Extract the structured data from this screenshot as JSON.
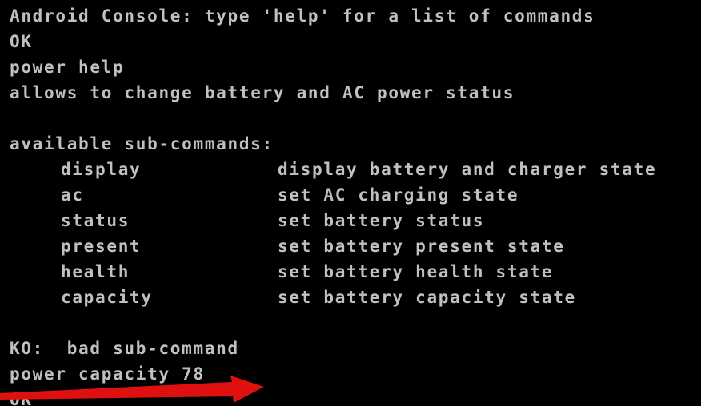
{
  "console": {
    "header": "Android Console: type 'help' for a list of commands",
    "ok1": "OK",
    "cmd1": "power help",
    "help_desc": "allows to change battery and AC power status",
    "subcommands_heading": "available sub-commands:",
    "subcommands": [
      {
        "name": "display",
        "desc": "display battery and charger state"
      },
      {
        "name": "ac",
        "desc": "set AC charging state"
      },
      {
        "name": "status",
        "desc": "set battery status"
      },
      {
        "name": "present",
        "desc": "set battery present state"
      },
      {
        "name": "health",
        "desc": "set battery health state"
      },
      {
        "name": "capacity",
        "desc": "set battery capacity state"
      }
    ],
    "error": "KO:  bad sub-command",
    "cmd2": "power capacity 78",
    "ok2": "OK"
  },
  "colors": {
    "background": "#000000",
    "text": "#c0c0c0",
    "annotation_arrow": "#e01010"
  },
  "icons": {
    "annotation": "red-arrow-icon"
  }
}
